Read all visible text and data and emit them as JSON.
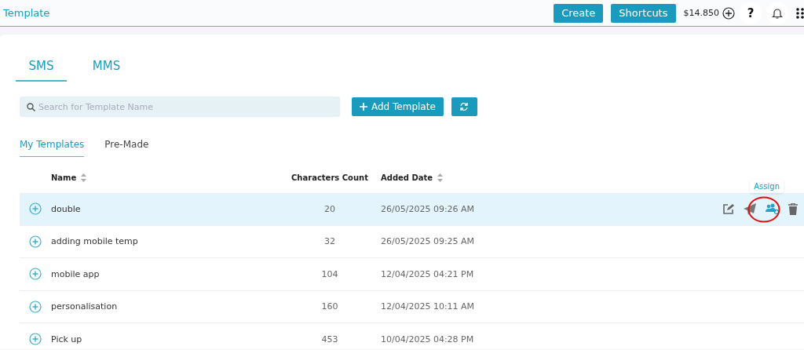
{
  "header": {
    "title": "Template",
    "buttons": [
      "Create",
      "Shortcuts"
    ],
    "balance": "$14.850",
    "help": "?"
  },
  "channel_tabs": [
    {
      "label": "SMS",
      "selected": true
    },
    {
      "label": "MMS",
      "selected": false
    }
  ],
  "search": {
    "placeholder": "Search for Template Name"
  },
  "add_button": "Add Template",
  "template_tabs": [
    {
      "label": "My Templates",
      "selected": true
    },
    {
      "label": "Pre-Made",
      "selected": false
    }
  ],
  "table": {
    "columns": [
      {
        "label": "Name",
        "sortable": true
      },
      {
        "label": "Characters Count",
        "sortable": false
      },
      {
        "label": "Added Date",
        "sortable": true
      }
    ],
    "rows": [
      {
        "name": "double",
        "count": "20",
        "date": "26/05/2025 09:26 AM",
        "selected": true,
        "tooltip": "Assign"
      },
      {
        "name": "adding mobile temp",
        "count": "32",
        "date": "26/05/2025 09:25 AM",
        "selected": false
      },
      {
        "name": "mobile app",
        "count": "104",
        "date": "12/04/2025 04:21 PM",
        "selected": false
      },
      {
        "name": "personalisation",
        "count": "160",
        "date": "12/04/2025 10:11 AM",
        "selected": false
      },
      {
        "name": "Pick up",
        "count": "453",
        "date": "10/04/2025 04:28 PM",
        "selected": false
      }
    ]
  }
}
